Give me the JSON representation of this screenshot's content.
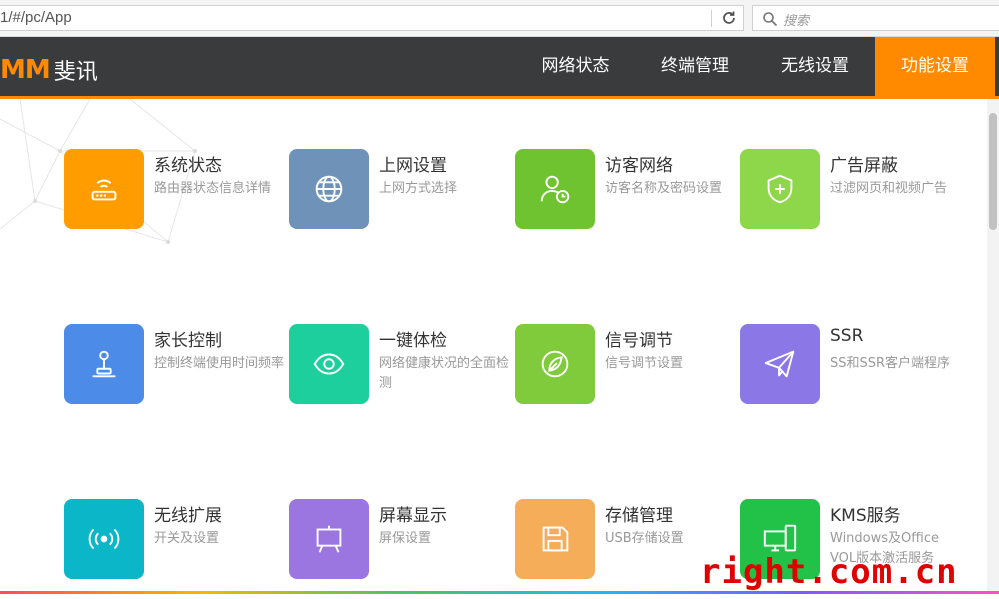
{
  "browser": {
    "url": "1/#/pc/App",
    "search_placeholder": "搜索"
  },
  "header": {
    "logo_mark": "MM",
    "logo_text": "斐讯",
    "nav": [
      {
        "label": "网络状态",
        "active": false
      },
      {
        "label": "终端管理",
        "active": false
      },
      {
        "label": "无线设置",
        "active": false
      },
      {
        "label": "功能设置",
        "active": true
      }
    ],
    "accent_color": "#ff8a00",
    "bg_color": "#3a3b3d"
  },
  "apps": [
    {
      "title": "系统状态",
      "desc": "路由器状态信息详情",
      "icon": "router-icon",
      "color": "#ff9d00"
    },
    {
      "title": "上网设置",
      "desc": "上网方式选择",
      "icon": "globe-icon",
      "color": "#6f93b8"
    },
    {
      "title": "访客网络",
      "desc": "访客名称及密码设置",
      "icon": "guest-user-icon",
      "color": "#6fc230"
    },
    {
      "title": "广告屏蔽",
      "desc": "过滤网页和视频广告",
      "icon": "shield-plus-icon",
      "color": "#8ed64a"
    },
    {
      "title": "家长控制",
      "desc": "控制终端使用时间频率",
      "icon": "joystick-icon",
      "color": "#4c8be8"
    },
    {
      "title": "一键体检",
      "desc": "网络健康状况的全面检测",
      "icon": "eye-icon",
      "color": "#1ccf9d"
    },
    {
      "title": "信号调节",
      "desc": "信号调节设置",
      "icon": "leaf-icon",
      "color": "#7fcb3c"
    },
    {
      "title": "SSR",
      "desc": "SS和SSR客户端程序",
      "icon": "paper-plane-icon",
      "color": "#8b78e6"
    },
    {
      "title": "无线扩展",
      "desc": "开关及设置",
      "icon": "wireless-icon",
      "color": "#0ab6c8"
    },
    {
      "title": "屏幕显示",
      "desc": "屏保设置",
      "icon": "easel-icon",
      "color": "#9b76e0"
    },
    {
      "title": "存储管理",
      "desc": "USB存储设置",
      "icon": "floppy-icon",
      "color": "#f5ad5a"
    },
    {
      "title": "KMS服务",
      "desc": "Windows及Office VOL版本激活服务",
      "icon": "computer-icon",
      "color": "#22c147"
    }
  ],
  "watermark": "right.com.cn"
}
